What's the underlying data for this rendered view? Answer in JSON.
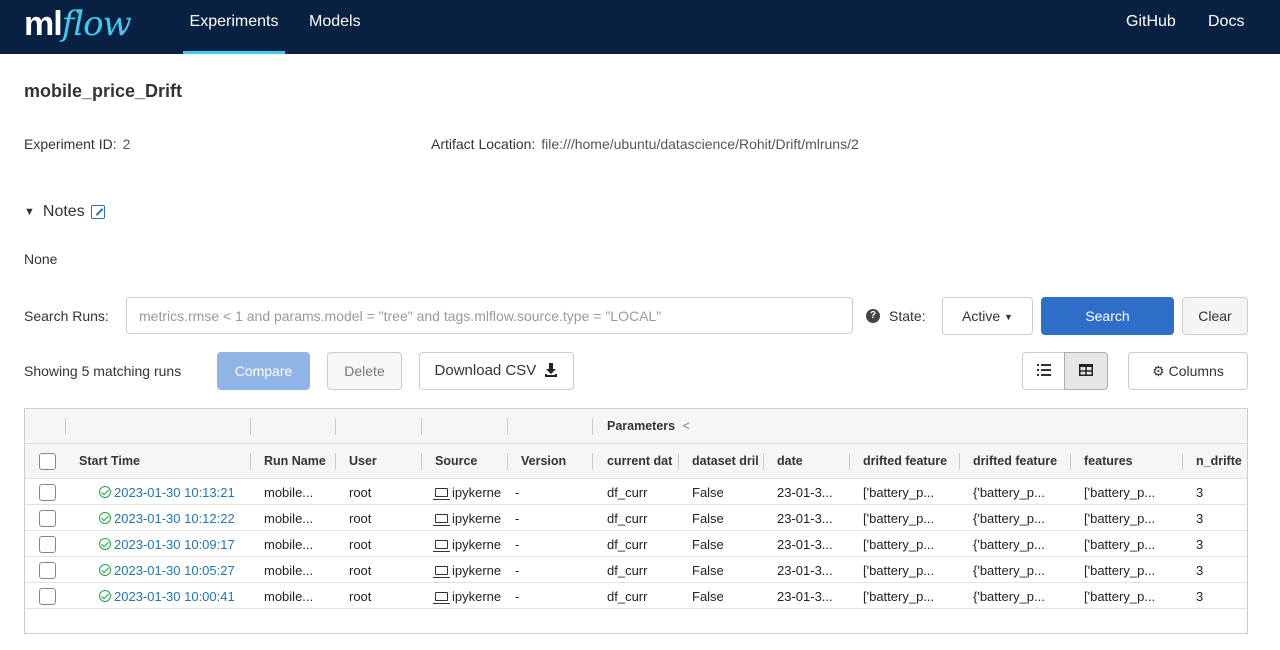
{
  "header": {
    "logo_ml": "ml",
    "logo_flow": "flow",
    "nav": [
      "Experiments",
      "Models"
    ],
    "right_links": [
      "GitHub",
      "Docs"
    ]
  },
  "experiment": {
    "title": "mobile_price_Drift",
    "id_label": "Experiment ID:",
    "id_value": "2",
    "artifact_label": "Artifact Location:",
    "artifact_value": "file:///home/ubuntu/datascience/Rohit/Drift/mlruns/2"
  },
  "notes": {
    "label": "Notes",
    "value": "None"
  },
  "search": {
    "label": "Search Runs:",
    "placeholder": "metrics.rmse < 1 and params.model = \"tree\" and tags.mlflow.source.type = \"LOCAL\"",
    "state_label": "State:",
    "state_value": "Active",
    "search_button": "Search",
    "clear_button": "Clear"
  },
  "actions": {
    "showing": "Showing 5 matching runs",
    "compare": "Compare",
    "delete": "Delete",
    "download_csv": "Download CSV",
    "columns": "Columns"
  },
  "table": {
    "group_header": "Parameters",
    "columns": [
      "Start Time",
      "Run Name",
      "User",
      "Source",
      "Version",
      "current dat",
      "dataset dril",
      "date",
      "drifted feature",
      "drifted feature",
      "features",
      "n_drifte"
    ],
    "rows": [
      {
        "start": "2023-01-30 10:13:21",
        "name": "mobile...",
        "user": "root",
        "source": "ipykerne",
        "version": "-",
        "current": "df_curr",
        "dataset": "False",
        "date": "23-01-3...",
        "df1": "['battery_p...",
        "df2": "{'battery_p...",
        "features": "['battery_p...",
        "n": "3"
      },
      {
        "start": "2023-01-30 10:12:22",
        "name": "mobile...",
        "user": "root",
        "source": "ipykerne",
        "version": "-",
        "current": "df_curr",
        "dataset": "False",
        "date": "23-01-3...",
        "df1": "['battery_p...",
        "df2": "{'battery_p...",
        "features": "['battery_p...",
        "n": "3"
      },
      {
        "start": "2023-01-30 10:09:17",
        "name": "mobile...",
        "user": "root",
        "source": "ipykerne",
        "version": "-",
        "current": "df_curr",
        "dataset": "False",
        "date": "23-01-3...",
        "df1": "['battery_p...",
        "df2": "{'battery_p...",
        "features": "['battery_p...",
        "n": "3"
      },
      {
        "start": "2023-01-30 10:05:27",
        "name": "mobile...",
        "user": "root",
        "source": "ipykerne",
        "version": "-",
        "current": "df_curr",
        "dataset": "False",
        "date": "23-01-3...",
        "df1": "['battery_p...",
        "df2": "{'battery_p...",
        "features": "['battery_p...",
        "n": "3"
      },
      {
        "start": "2023-01-30 10:00:41",
        "name": "mobile...",
        "user": "root",
        "source": "ipykerne",
        "version": "-",
        "current": "df_curr",
        "dataset": "False",
        "date": "23-01-3...",
        "df1": "['battery_p...",
        "df2": "{'battery_p...",
        "features": "['battery_p...",
        "n": "3"
      }
    ]
  },
  "colors": {
    "header_bg": "#082142",
    "accent": "#43c9ed",
    "primary": "#2e6ec9",
    "link": "#2374bb",
    "success": "#27a344"
  },
  "icons": [
    "edit-icon",
    "help-icon",
    "caret-down-icon",
    "download-icon",
    "list-view-icon",
    "grid-view-icon",
    "gear-icon",
    "check-circle-icon",
    "laptop-icon",
    "chevron-left-icon"
  ]
}
